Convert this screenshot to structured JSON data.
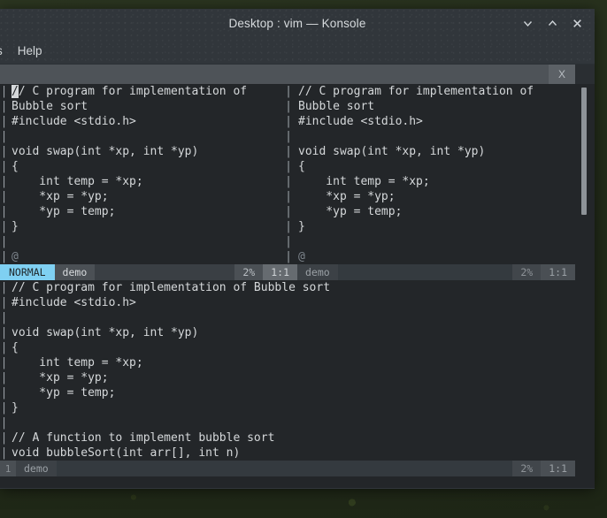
{
  "window": {
    "title": "Desktop : vim — Konsole",
    "controls": [
      {
        "name": "minimize",
        "glyph": "minimize-icon"
      },
      {
        "name": "maximize",
        "glyph": "maximize-icon"
      },
      {
        "name": "close",
        "glyph": "close-icon"
      }
    ]
  },
  "menubar": {
    "items": [
      {
        "label": "s",
        "clipped": true
      },
      {
        "label": "Help",
        "clipped": false
      }
    ]
  },
  "tabbar": {
    "close_label": "X"
  },
  "colors": {
    "terminal_bg": "#232629",
    "window_chrome": "#31363b",
    "tabbar_bg": "#4e5358",
    "statusline_mode_active_bg": "#7fd0f2",
    "statusline_mode_active_fg": "#1f2629",
    "text_fg": "#d5d8da",
    "desktop": "#2b3520"
  },
  "editor": {
    "split_marker": "|",
    "empty_line_marker": "@",
    "top_left_pane": {
      "cursor_char": "/",
      "lines": [
        "/ C program for implementation of",
        "Bubble sort",
        "#include <stdio.h>",
        "",
        "void swap(int *xp, int *yp)",
        "{",
        "    int temp = *xp;",
        "    *xp = *yp;",
        "    *yp = temp;",
        "}"
      ],
      "statusline": {
        "mode": "NORMAL",
        "file": "demo",
        "percent": "2%",
        "position": "1:1",
        "active": true
      }
    },
    "top_right_pane": {
      "lines": [
        "// C program for implementation of",
        "Bubble sort",
        "#include <stdio.h>",
        "",
        "void swap(int *xp, int *yp)",
        "{",
        "    int temp = *xp;",
        "    *xp = *yp;",
        "    *yp = temp;",
        "}"
      ],
      "statusline": {
        "mode": "",
        "file": "demo",
        "percent": "2%",
        "position": "1:1",
        "active": false
      }
    },
    "bottom_pane": {
      "lines": [
        "// C program for implementation of Bubble sort",
        "#include <stdio.h>",
        "",
        "void swap(int *xp, int *yp)",
        "{",
        "    int temp = *xp;",
        "    *xp = *yp;",
        "    *yp = temp;",
        "}",
        "",
        "// A function to implement bubble sort",
        "void bubbleSort(int arr[], int n)"
      ],
      "statusline": {
        "mode": "",
        "file": "demo",
        "percent": "2%",
        "position": "1:1",
        "active": false,
        "edge_label": "1"
      }
    }
  }
}
